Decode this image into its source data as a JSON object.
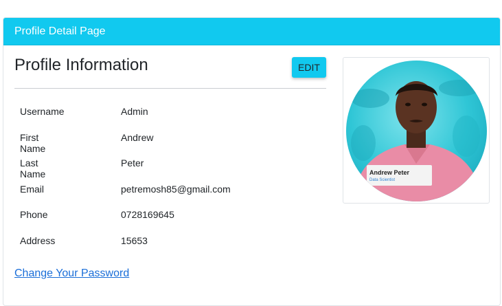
{
  "header": {
    "title": "Profile Detail Page"
  },
  "profile": {
    "heading": "Profile Information",
    "edit_label": "EDIT",
    "fields": [
      {
        "label": "Username",
        "value": "Admin"
      },
      {
        "label": "First Name",
        "value": "Andrew"
      },
      {
        "label": "Last Name",
        "value": "Peter"
      },
      {
        "label": "Email",
        "value": "petremosh85@gmail.com"
      },
      {
        "label": "Phone",
        "value": "0728169645"
      },
      {
        "label": "Address",
        "value": "15653"
      }
    ],
    "change_password_label": "Change Your Password"
  },
  "photo": {
    "name_tag": "Andrew Peter",
    "role_tag": "Data Scientist"
  },
  "colors": {
    "accent": "#11c9ef",
    "link": "#1a6ed8",
    "shirt": "#e98ca6"
  }
}
